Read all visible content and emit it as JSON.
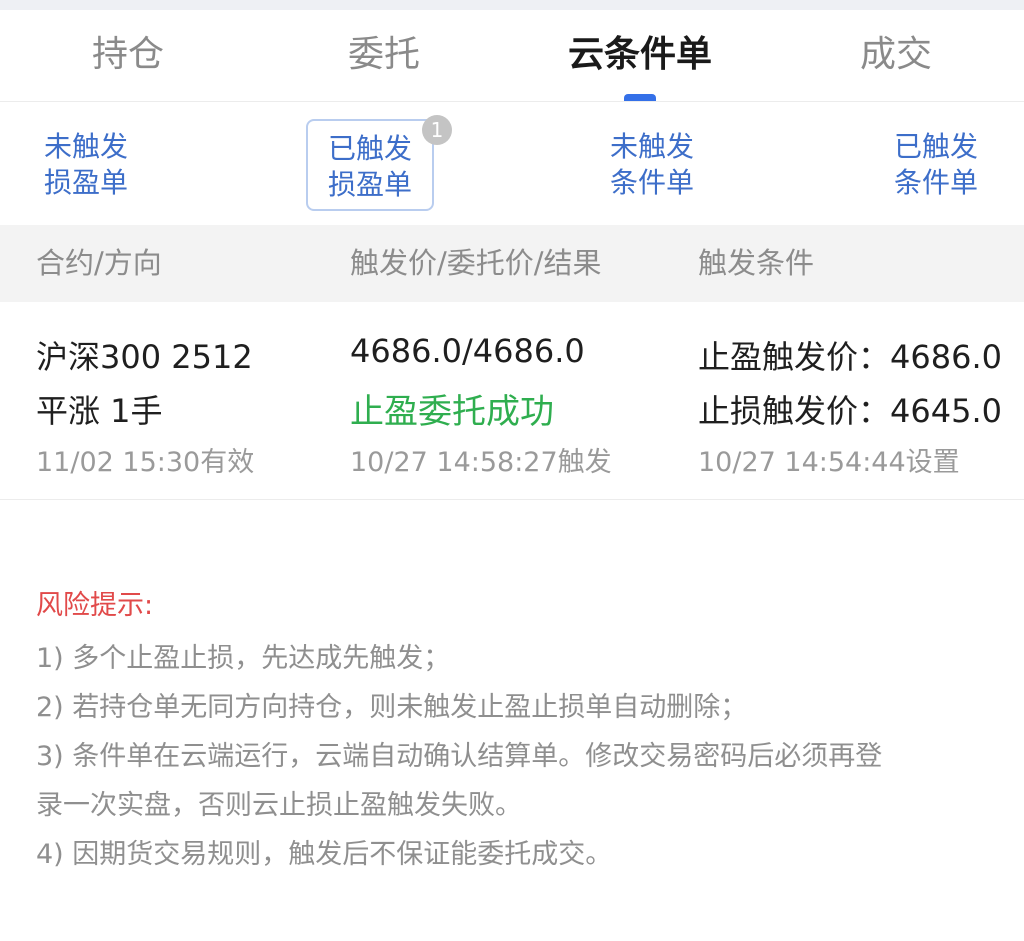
{
  "tabs": [
    "持仓",
    "委托",
    "云条件单",
    "成交"
  ],
  "active_tab": "云条件单",
  "subtabs": [
    {
      "line1": "未触发",
      "line2": "损盈单"
    },
    {
      "line1": "已触发",
      "line2": "损盈单",
      "badge": "1"
    },
    {
      "line1": "未触发",
      "line2": "条件单"
    },
    {
      "line1": "已触发",
      "line2": "条件单"
    }
  ],
  "table": {
    "headers": [
      "合约/方向",
      "触发价/委托价/结果",
      "触发条件"
    ],
    "row": {
      "contract": "沪深300 2512",
      "direction": "平涨 1手",
      "valid_until": "11/02 15:30有效",
      "prices": "4686.0/4686.0",
      "result": "止盈委托成功",
      "trigger_time": "10/27 14:58:27触发",
      "tp_condition": "止盈触发价：4686.0",
      "sl_condition": "止损触发价：4645.0",
      "set_time": "10/27 14:54:44设置"
    }
  },
  "risk": {
    "title": "风险提示:",
    "items": [
      "1) 多个止盈止损，先达成先触发；",
      "2) 若持仓单无同方向持仓，则未触发止盈止损单自动删除；",
      "3) 条件单在云端运行，云端自动确认结算单。修改交易密码后必须再登",
      "录一次实盘，否则云止损止盈触发失败。",
      "4) 因期货交易规则，触发后不保证能委托成交。"
    ]
  },
  "colors": {
    "accent": "#3470e8",
    "subtab_text": "#3d6ec9",
    "success": "#2fae4f",
    "risk_title": "#e14a4a"
  }
}
